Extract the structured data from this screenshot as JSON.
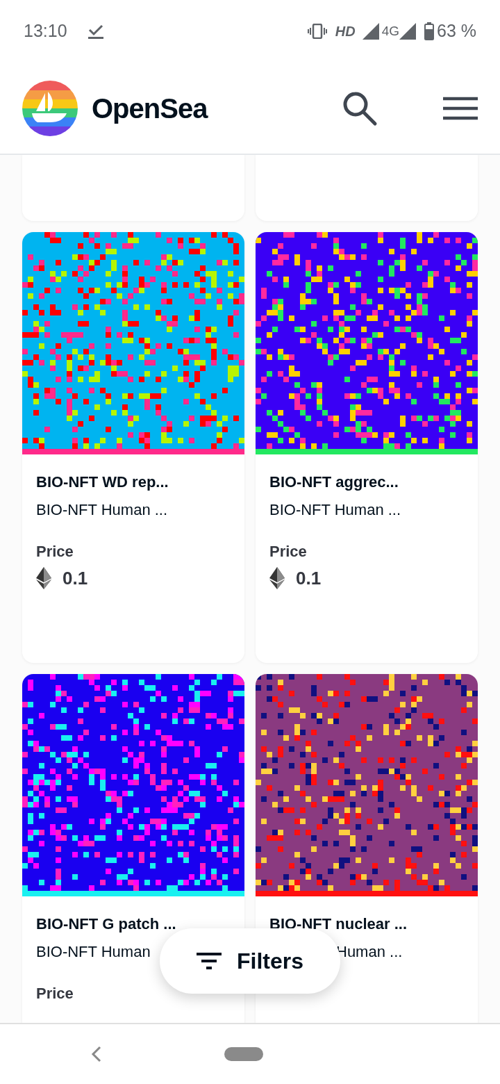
{
  "status_bar": {
    "time": "13:10",
    "network": "HD",
    "network_type": "4G",
    "battery": "63 %"
  },
  "header": {
    "title": "OpenSea"
  },
  "cards": [
    {
      "kind": "partial"
    },
    {
      "kind": "partial"
    },
    {
      "kind": "full",
      "title": "BIO-NFT WD rep...",
      "subtitle": "BIO-NFT Human ...",
      "price_label": "Price",
      "price": "0.1"
    },
    {
      "kind": "full",
      "title": "BIO-NFT aggrec...",
      "subtitle": "BIO-NFT Human ...",
      "price_label": "Price",
      "price": "0.1"
    },
    {
      "kind": "full",
      "title": "BIO-NFT G patch ...",
      "subtitle": "BIO-NFT Human",
      "price_label": "Price"
    },
    {
      "kind": "full",
      "title": "BIO-NFT nuclear ...",
      "subtitle": "Human ...",
      "subtitle_covered": true
    }
  ],
  "filters_button": {
    "label": "Filters"
  }
}
